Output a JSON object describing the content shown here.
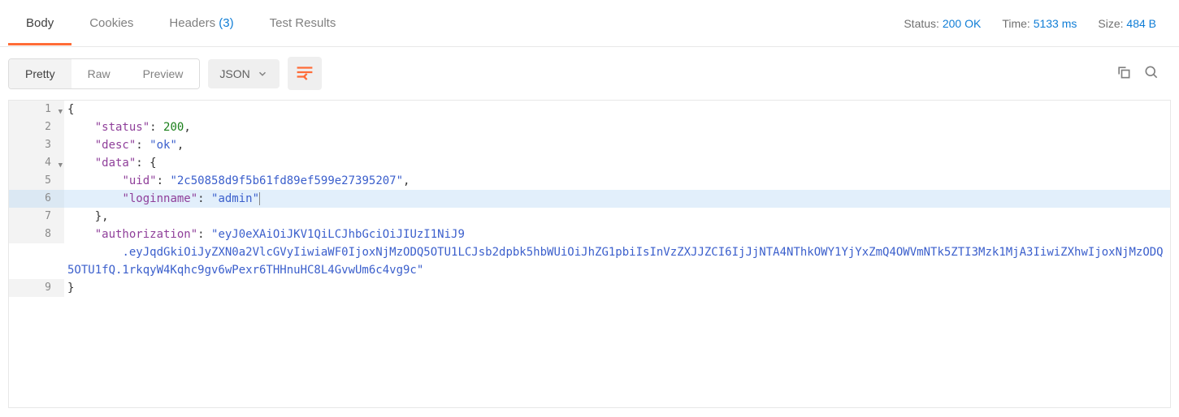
{
  "tabs": {
    "body": "Body",
    "cookies": "Cookies",
    "headers": "Headers",
    "headers_count": "(3)",
    "test_results": "Test Results"
  },
  "status_bar": {
    "status_label": "Status:",
    "status_value": "200 OK",
    "time_label": "Time:",
    "time_value": "5133 ms",
    "size_label": "Size:",
    "size_value": "484 B"
  },
  "view_modes": {
    "pretty": "Pretty",
    "raw": "Raw",
    "preview": "Preview"
  },
  "format_select": "JSON",
  "code": {
    "lines": [
      "1",
      "2",
      "3",
      "4",
      "5",
      "6",
      "7",
      "8",
      "9"
    ],
    "l1": "{",
    "l2_key": "\"status\"",
    "l2_val": "200",
    "l3_key": "\"desc\"",
    "l3_val": "\"ok\"",
    "l4_key": "\"data\"",
    "l5_key": "\"uid\"",
    "l5_val": "\"2c50858d9f5b61fd89ef599e27395207\"",
    "l6_key": "\"loginname\"",
    "l6_val": "\"admin\"",
    "l7": "},",
    "l8_key": "\"authorization\"",
    "l8_val_a": "\"eyJ0eXAiOiJKV1QiLCJhbGciOiJIUzI1NiJ9",
    "l8_val_b": ".eyJqdGkiOiJyZXN0a2VlcGVyIiwiaWF0IjoxNjMzODQ5OTU1LCJsb2dpbk5hbWUiOiJhZG1pbiIsInVzZXJJZCI6IjJjNTA4NThkOWY1YjYxZmQ4OWVmNTk5ZTI3Mzk1MjA3IiwiZXhwIjoxNjMzODQ5OTU1fQ.1rkqyW4Kqhc9gv6wPexr6THHnuHC8L4GvwUm6c4vg9c\"",
    "l9": "}"
  }
}
